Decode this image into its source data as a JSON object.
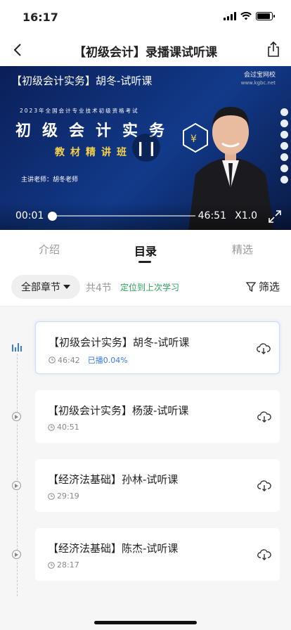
{
  "status_bar": {
    "time": "16:17"
  },
  "nav": {
    "title": "【初级会计】录播课试听课",
    "back_icon": "chevron-left-icon",
    "share_icon": "share-icon"
  },
  "player": {
    "video_title": "【初级会计实务】胡冬-试听课",
    "logo_text": "会过宝网校",
    "logo_url_text": "www.kgbc.net",
    "exam_line": "2023年全国会计专业技术初级资格考试",
    "big_title": "初级会计实务",
    "subtitle": "教材精讲班",
    "teacher_line": "主讲老师：胡冬老师",
    "badge_char": "¥",
    "current_time": "00:01",
    "duration": "46:51",
    "speed": "X1.0",
    "progress": 0.0004
  },
  "tabs": [
    {
      "label": "介绍"
    },
    {
      "label": "目录"
    },
    {
      "label": "精选"
    }
  ],
  "filter": {
    "chapters_label": "全部章节",
    "count_label": "共4节",
    "locate_label": "定位到上次学习",
    "filter_label": "筛选"
  },
  "lessons": [
    {
      "title": "【初级会计实务】胡冬-试听课",
      "duration": "46:42",
      "played": "已播0.04%"
    },
    {
      "title": "【初级会计实务】杨菠-试听课",
      "duration": "40:51"
    },
    {
      "title": "【经济法基础】孙林-试听课",
      "duration": "29:19"
    },
    {
      "title": "【经济法基础】陈杰-试听课",
      "duration": "28:17"
    }
  ]
}
